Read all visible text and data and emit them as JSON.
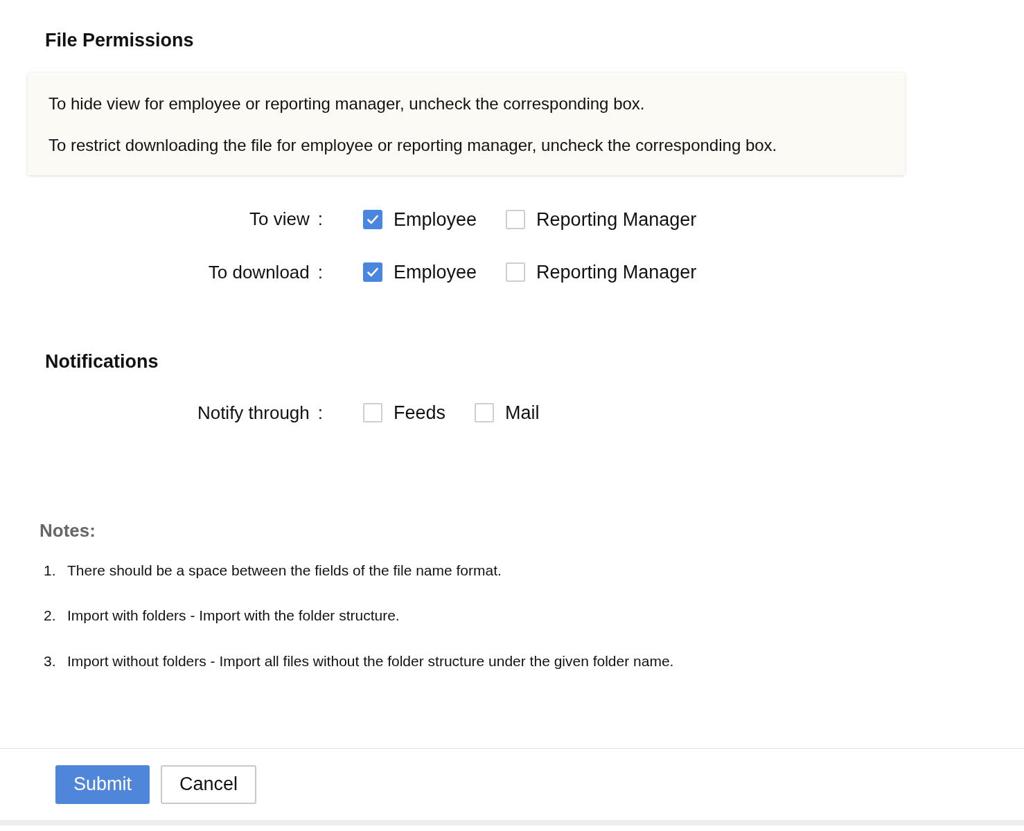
{
  "title": "File Permissions",
  "info": [
    "To hide view for employee or reporting manager, uncheck the corresponding box.",
    "To restrict downloading the file for employee or reporting manager, uncheck the corresponding box."
  ],
  "permissions": [
    {
      "label": "To view",
      "separator": ":",
      "options": [
        {
          "label": "Employee",
          "checked": true
        },
        {
          "label": "Reporting Manager",
          "checked": false
        }
      ]
    },
    {
      "label": "To download",
      "separator": ":",
      "options": [
        {
          "label": "Employee",
          "checked": true
        },
        {
          "label": "Reporting Manager",
          "checked": false
        }
      ]
    }
  ],
  "notifications": {
    "title": "Notifications",
    "rows": [
      {
        "label": "Notify through",
        "separator": ":",
        "options": [
          {
            "label": "Feeds",
            "checked": false
          },
          {
            "label": "Mail",
            "checked": false
          }
        ]
      }
    ]
  },
  "notes": {
    "title": "Notes:",
    "items": [
      {
        "number": "1.",
        "text": "There should be a space between the fields of the file name format."
      },
      {
        "number": "2.",
        "text": "Import with folders - Import with the folder structure."
      },
      {
        "number": "3.",
        "text": "Import without folders - Import all files without the folder structure under the given folder name."
      }
    ]
  },
  "buttons": [
    {
      "label": "Submit",
      "kind": "primary"
    },
    {
      "label": "Cancel",
      "kind": "secondary"
    }
  ]
}
